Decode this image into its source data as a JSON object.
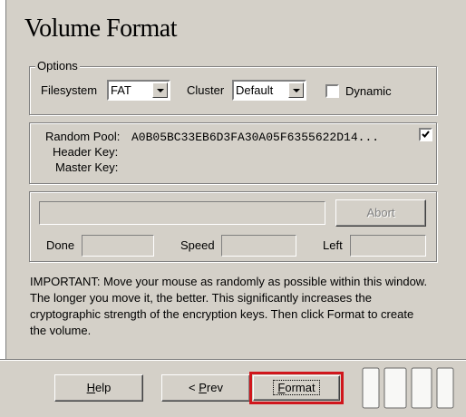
{
  "title": "Volume Format",
  "options": {
    "legend": "Options",
    "filesystem_label": "Filesystem",
    "filesystem_value": "FAT",
    "cluster_label": "Cluster",
    "cluster_value": "Default",
    "dynamic_label": "Dynamic",
    "dynamic_checked": false
  },
  "keys": {
    "random_pool_label": "Random Pool:",
    "random_pool_value": "A0B05BC33EB6D3FA30A05F6355622D14...",
    "header_key_label": "Header Key:",
    "master_key_label": "Master Key:",
    "show_checked": true
  },
  "progress": {
    "abort_label": "Abort",
    "done_label": "Done",
    "speed_label": "Speed",
    "left_label": "Left",
    "percent": 0
  },
  "info": {
    "text": "IMPORTANT: Move your mouse as randomly as possible within this window. The longer you move it, the better. This significantly increases the cryptographic strength of the encryption keys. Then click Format to create the volume."
  },
  "buttons": {
    "help_prefix": "",
    "help_underline": "H",
    "help_rest": "elp",
    "prev_prefix": "< ",
    "prev_underline": "P",
    "prev_rest": "rev",
    "format_prefix": "",
    "format_underline": "F",
    "format_rest": "ormat"
  }
}
